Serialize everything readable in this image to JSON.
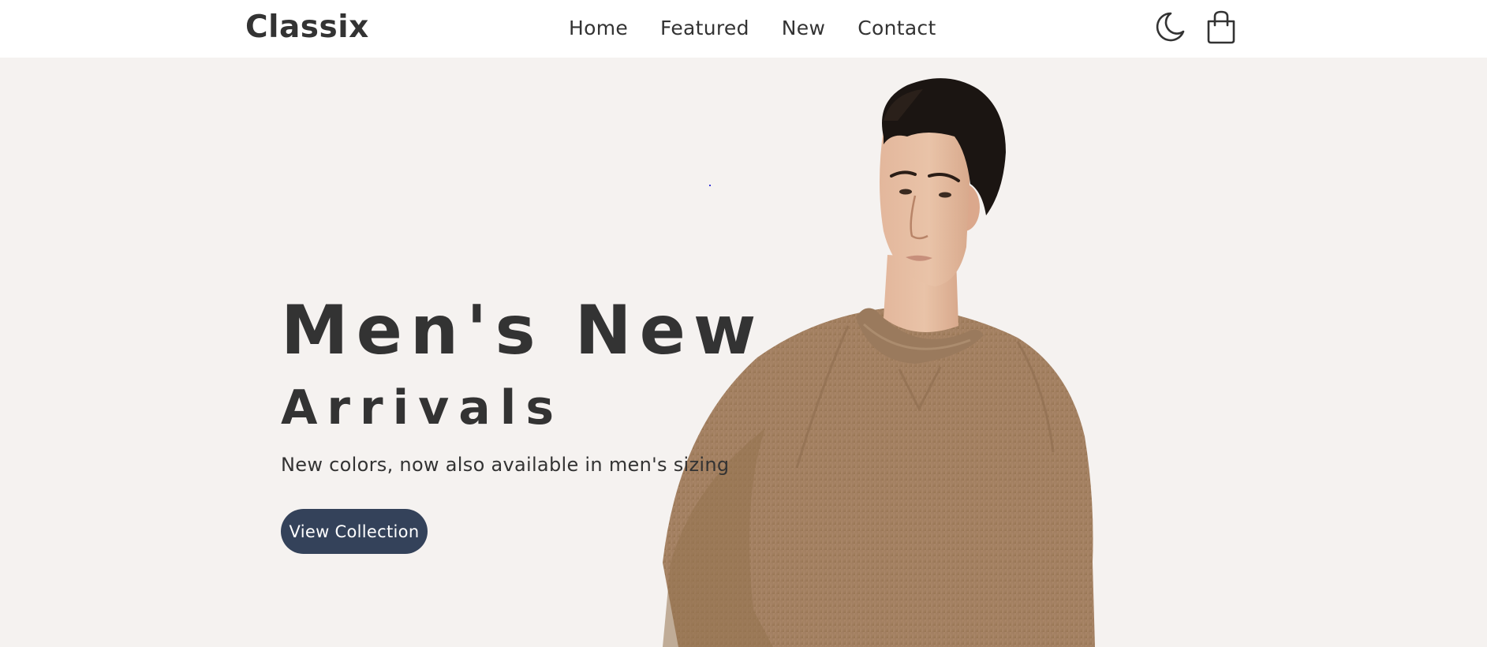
{
  "header": {
    "logo": "Classix",
    "nav": [
      "Home",
      "Featured",
      "New",
      "Contact"
    ],
    "icons": [
      "moon-icon",
      "shopping-bag-icon"
    ]
  },
  "hero": {
    "title": "Men's New",
    "subtitle": "Arrivals",
    "description": "New colors, now also available in men's sizing",
    "cta_label": "View Collection",
    "image": "man-in-brown-sweater-image"
  },
  "colors": {
    "background": "#f5f2f0",
    "header_bg": "#ffffff",
    "text": "#333333",
    "button_bg": "#34425a",
    "button_text": "#ffffff",
    "sweater": "#a68466"
  }
}
